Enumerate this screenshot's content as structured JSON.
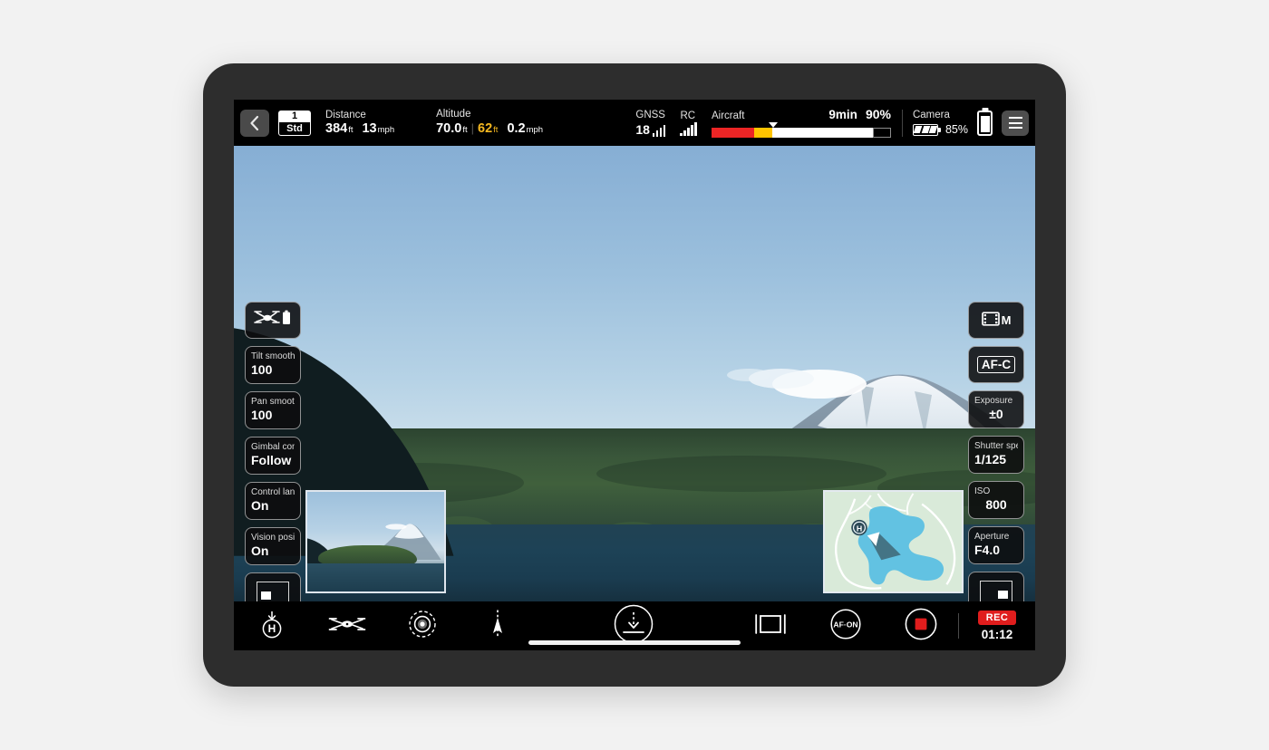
{
  "device": {
    "name": "tablet-drone-controller"
  },
  "topbar": {
    "back_icon": "chevron-left-icon",
    "mode_badge": {
      "number": "1",
      "label": "Std"
    },
    "distance": {
      "label": "Distance",
      "value": "384",
      "unit": "ft",
      "speed_value": "13",
      "speed_unit": "mph"
    },
    "altitude": {
      "label": "Altitude",
      "value": "70.0",
      "unit": "ft",
      "relative_value": "62",
      "relative_unit": "ft",
      "vertical_speed": "0.2",
      "vertical_speed_unit": "mph",
      "relative_color": "#f5b820"
    },
    "gnss": {
      "label": "GNSS",
      "satellites": "18",
      "bars": 5,
      "bars_active": 3
    },
    "rc": {
      "label": "RC",
      "bars": 5,
      "bars_active": 5
    },
    "aircraft": {
      "label": "Aircraft",
      "time_remaining": "9min",
      "battery_percent": "90%",
      "bar": {
        "critical_pct": 24,
        "warning_pct": 10,
        "charge_pct": 56,
        "empty_pct": 10
      },
      "colors": {
        "critical": "#ec2525",
        "warning": "#ffc400",
        "charge": "#ffffff"
      }
    },
    "camera": {
      "label": "Camera",
      "battery_percent": "85%",
      "battery_icon": "battery-icon"
    },
    "controller_battery": {
      "icon": "battery-vertical-icon",
      "level_pct": 88
    },
    "menu_button": {
      "icon": "hamburger-menu-icon"
    }
  },
  "left_panel": {
    "aircraft_battery_tile": {
      "icon": "drone-battery-icon"
    },
    "tiles": [
      {
        "label": "Tilt smoothness",
        "value": "100",
        "name": "tilt-smoothness"
      },
      {
        "label": "Pan smoothness",
        "value": "100",
        "name": "pan-smoothness"
      },
      {
        "label": "Gimbal control mode",
        "value": "Follow",
        "name": "gimbal-mode"
      },
      {
        "label": "Control landing gear",
        "value": "On",
        "name": "control-landing-gear"
      },
      {
        "label": "Vision positioning",
        "value": "On",
        "name": "vision-positioning"
      }
    ],
    "pip_toggle": {
      "icon": "pip-bottom-left-icon"
    }
  },
  "right_panel": {
    "record_mode": {
      "icon": "film-strip-icon",
      "value": "M",
      "name": "video-mode"
    },
    "focus_mode": {
      "value": "AF-C",
      "name": "focus-mode"
    },
    "tiles": [
      {
        "label": "Exposure",
        "value": "±0",
        "name": "exposure-compensation"
      },
      {
        "label": "Shutter speed",
        "value": "1/125",
        "name": "shutter-speed"
      },
      {
        "label": "ISO",
        "value": "800",
        "name": "iso"
      },
      {
        "label": "Aperture",
        "value": "F4.0",
        "name": "aperture"
      }
    ],
    "pip_toggle": {
      "icon": "pip-bottom-right-icon"
    }
  },
  "map": {
    "home_marker": "H",
    "aircraft_marker": "aircraft-heading-icon",
    "colors": {
      "land": "#d9ead9",
      "water": "#64c3e2",
      "road": "#ffffff"
    }
  },
  "bottombar": {
    "items": [
      {
        "name": "return-to-home-button",
        "icon": "return-to-home-icon"
      },
      {
        "name": "aircraft-settings-button",
        "icon": "drone-icon"
      },
      {
        "name": "gimbal-recenter-button",
        "icon": "gimbal-target-icon"
      },
      {
        "name": "heading-button",
        "icon": "compass-arrow-icon"
      },
      {
        "name": "landing-button",
        "icon": "land-arrow-down-icon"
      },
      {
        "name": "display-layout-button",
        "icon": "screen-frame-icon"
      },
      {
        "name": "af-on-button",
        "icon": "af-on-icon",
        "label": "AF·ON"
      },
      {
        "name": "stop-record-button",
        "icon": "stop-square-icon"
      }
    ],
    "recording": {
      "badge": "REC",
      "elapsed": "01:12",
      "badge_color": "#e01d1d"
    }
  }
}
